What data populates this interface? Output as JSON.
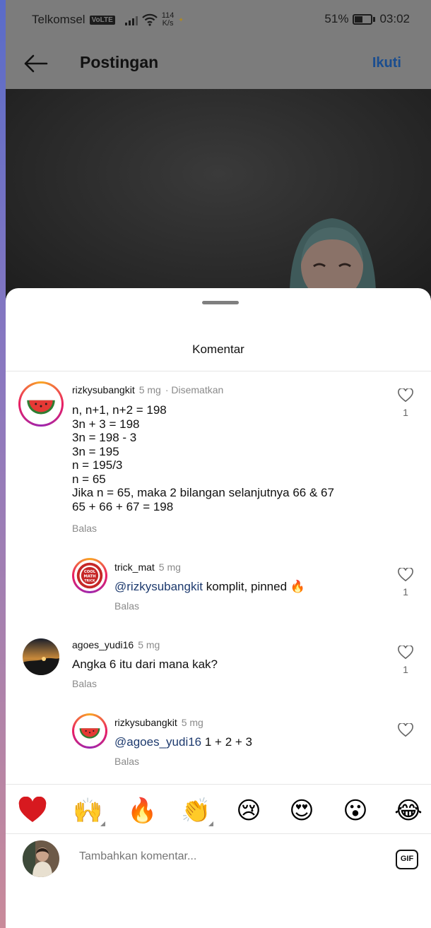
{
  "status_bar": {
    "carrier": "Telkomsel",
    "volte": "VoLTE",
    "net_speed_value": "114",
    "net_speed_unit": "K/s",
    "battery_percent": "51%",
    "battery_level": 0.51,
    "time": "03:02"
  },
  "header": {
    "title": "Postingan",
    "follow_label": "Ikuti"
  },
  "sheet": {
    "title": "Komentar"
  },
  "comments": [
    {
      "username": "rizkysubangkit",
      "time": "5 mg",
      "pinned_label": "· Disematkan",
      "lines": [
        "n, n+1, n+2 = 198",
        "3n + 3 = 198",
        "3n = 198 - 3",
        "3n = 195",
        "n = 195/3",
        "n = 65",
        "Jika n = 65, maka 2 bilangan selanjutnya 66 & 67",
        "65 + 66 + 67 = 198"
      ],
      "reply_label": "Balas",
      "likes": "1"
    },
    {
      "username": "trick_mat",
      "time": "5 mg",
      "mention": "@rizkysubangkit",
      "text": " komplit, pinned 🔥",
      "reply_label": "Balas",
      "likes": "1"
    },
    {
      "username": "agoes_yudi16",
      "time": "5 mg",
      "text": "Angka 6 itu dari mana kak?",
      "reply_label": "Balas",
      "likes": "1"
    },
    {
      "username": "rizkysubangkit",
      "time": "5 mg",
      "mention": "@agoes_yudi16",
      "text": " 1 + 2 + 3",
      "reply_label": "Balas"
    }
  ],
  "trick_mat_logo": "COOL MATH TRICK",
  "emoji_bar": [
    "❤️",
    "🙌",
    "🔥",
    "👏",
    "😢",
    "😍",
    "😮",
    "😂"
  ],
  "input": {
    "placeholder": "Tambahkan komentar...",
    "gif_label": "GIF"
  },
  "colors": {
    "link_blue": "#1a4d8f",
    "mention_blue": "#1d3a6e"
  }
}
